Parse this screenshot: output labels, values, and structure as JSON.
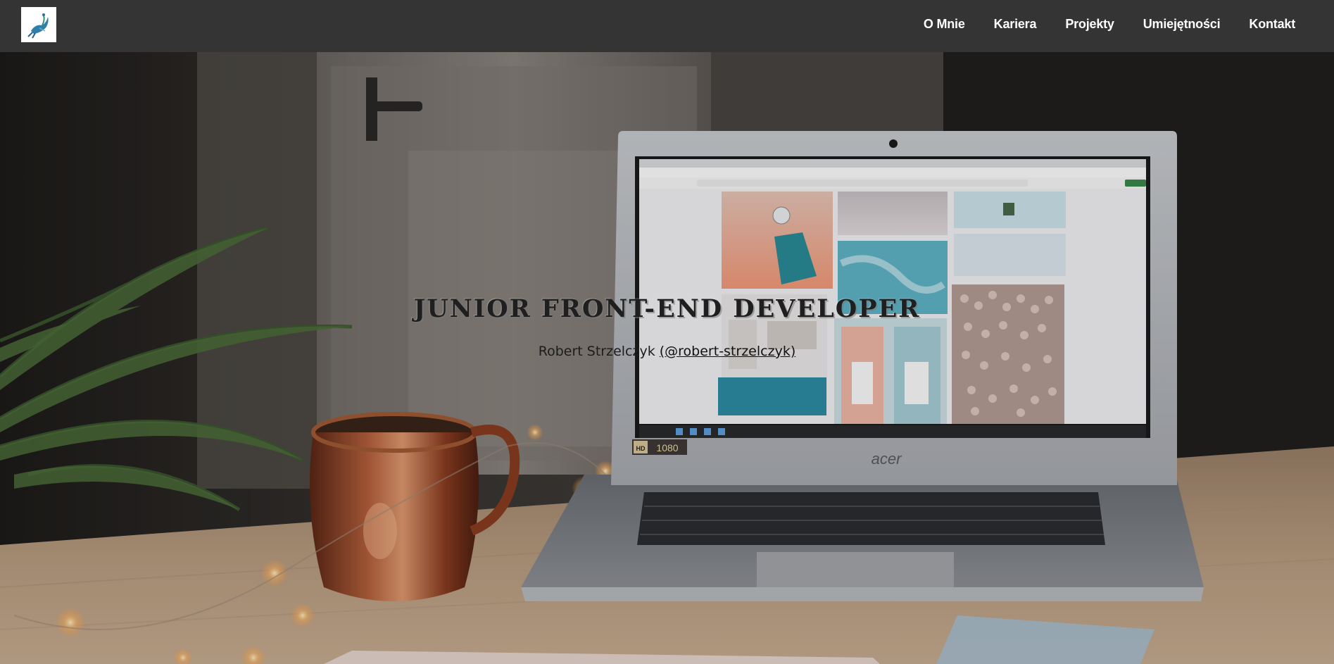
{
  "nav": {
    "logo_icon": "peacock-logo-icon",
    "links": [
      "O Mnie",
      "Kariera",
      "Projekty",
      "Umiejętności",
      "Kontakt"
    ]
  },
  "hero": {
    "title": "JUNIOR FRONT-END DEVELOPER",
    "author_name": "Robert Strzelczyk",
    "author_handle": "(@robert-strzelczyk)",
    "laptop_brand": "acer",
    "hd_badge_hd": "HD",
    "hd_badge_res": "1080"
  },
  "colors": {
    "navbar": "#343434",
    "nav_text": "#ffffff",
    "title_text": "#1f1f1f"
  }
}
